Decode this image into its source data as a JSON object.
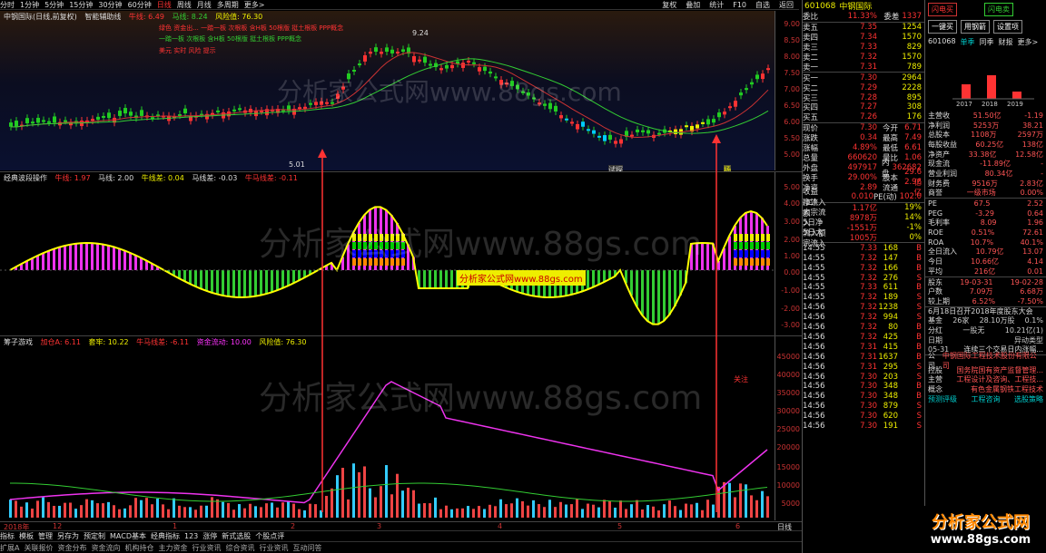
{
  "topbar": {
    "items": [
      "分时",
      "1分钟",
      "5分钟",
      "15分钟",
      "30分钟",
      "60分钟",
      "日线",
      "周线",
      "月线",
      "多周期",
      "更多>"
    ],
    "right": [
      "复权",
      "叠加",
      "统计",
      "F10",
      "自选",
      "返回"
    ]
  },
  "panel1": {
    "title": [
      "中钢国际(日线,前复权)",
      "智能辅助线",
      "牛线: 6.49",
      "马线: 8.24",
      "风险值: 76.30"
    ],
    "notes": [
      "绿色 资金出... 一踏一板 次根板 含H板 50根版 挺土根板 PPP概念",
      "一踏一板 次根板 含H板 50根版 挺土根板 PPP概念",
      "美元 实时 风险 提示"
    ],
    "price_high": "9.24",
    "price_low": "5.01",
    "axis": [
      "9.00",
      "8.50",
      "8.00",
      "7.50",
      "7.00",
      "6.50",
      "6.00",
      "5.50",
      "5.00"
    ],
    "labels": [
      "试探",
      "扬"
    ]
  },
  "panel2": {
    "title": [
      "经典波段操作",
      "牛线: 1.97",
      "马线: 2.00",
      "牛线差: 0.04",
      "马线差: -0.03",
      "牛马线差: -0.11"
    ],
    "axis": [
      "5.00",
      "4.00",
      "3.00",
      "2.00",
      "1.00",
      "0.00",
      "-1.00",
      "-2.00",
      "-3.00"
    ]
  },
  "panel3": {
    "title": [
      "筹子游戏",
      "加仓A: 6.11",
      "套牢: 10.22",
      "牛马线差: -6.11",
      "资金流动: 10.00",
      "风险值: 76.30"
    ],
    "axis": [
      "45000",
      "40000",
      "35000",
      "30000",
      "25000",
      "20000",
      "15000",
      "10000",
      "5000"
    ],
    "note": "关注"
  },
  "xaxis": [
    "2018年",
    "12",
    "1",
    "2",
    "3",
    "4",
    "5",
    "6",
    "日线"
  ],
  "tabs1": [
    "指标",
    "模板",
    "管理",
    "另存为",
    "预定制",
    "MACD基本",
    "经典指标",
    "123",
    "涨停",
    "新式选股",
    "个股点评"
  ],
  "tabs2": [
    "扩展A",
    "关联报价",
    "资金分布",
    "资金流向",
    "机构持仓",
    "主力资金",
    "行业资讯",
    "综合资讯",
    "行业资讯",
    "互动问答"
  ],
  "quote": {
    "code": "601068",
    "name": "中钢国际",
    "wb": [
      "委比",
      "11.33%",
      "委差",
      "1337"
    ],
    "asks": [
      [
        "卖五",
        "7.35",
        "1254"
      ],
      [
        "卖四",
        "7.34",
        "1570"
      ],
      [
        "卖三",
        "7.33",
        "829"
      ],
      [
        "卖二",
        "7.32",
        "1570"
      ],
      [
        "卖一",
        "7.31",
        "789"
      ]
    ],
    "bids": [
      [
        "买一",
        "7.30",
        "2964"
      ],
      [
        "买二",
        "7.29",
        "2228"
      ],
      [
        "买三",
        "7.28",
        "895"
      ],
      [
        "买四",
        "7.27",
        "308"
      ],
      [
        "买五",
        "7.26",
        "176"
      ]
    ],
    "stats": [
      [
        "现价",
        "7.30",
        "今开",
        "6.71"
      ],
      [
        "涨跌",
        "0.34",
        "最高",
        "7.49"
      ],
      [
        "涨幅",
        "4.89%",
        "最低",
        "6.61"
      ],
      [
        "总量",
        "660620",
        "量比",
        "1.06"
      ],
      [
        "外盘",
        "497917",
        "内盘",
        "362682"
      ],
      [
        "换手",
        "29.00%",
        "股本",
        "29.6亿"
      ],
      [
        "净资",
        "2.89",
        "流通",
        "2.96亿"
      ],
      [
        "收益(二)",
        "0.010",
        "PE(动)",
        "102.0"
      ]
    ],
    "flows": [
      [
        "净流入额",
        "1.17亿",
        "19%"
      ],
      [
        "大宗流入",
        "8978万",
        "14%"
      ],
      [
        "5日净流入额",
        "-1551万",
        "-1%"
      ],
      [
        "5日大宗流入",
        "1005万",
        "0%"
      ]
    ],
    "ticks": [
      [
        "14:55",
        "7.33",
        "168",
        "B"
      ],
      [
        "14:55",
        "7.32",
        "147",
        "B"
      ],
      [
        "14:55",
        "7.32",
        "166",
        "B"
      ],
      [
        "14:55",
        "7.32",
        "276",
        "S"
      ],
      [
        "14:55",
        "7.33",
        "611",
        "B"
      ],
      [
        "14:55",
        "7.32",
        "189",
        "S"
      ],
      [
        "14:56",
        "7.32",
        "1238",
        "S"
      ],
      [
        "14:56",
        "7.32",
        "994",
        "S"
      ],
      [
        "14:56",
        "7.32",
        "80",
        "B"
      ],
      [
        "14:56",
        "7.32",
        "425",
        "B"
      ],
      [
        "14:56",
        "7.31",
        "415",
        "B"
      ],
      [
        "14:56",
        "7.31",
        "1637",
        "B"
      ],
      [
        "14:56",
        "7.31",
        "295",
        "S"
      ],
      [
        "14:56",
        "7.30",
        "203",
        "S"
      ],
      [
        "14:56",
        "7.30",
        "348",
        "B"
      ],
      [
        "14:56",
        "7.30",
        "348",
        "B"
      ],
      [
        "14:56",
        "7.30",
        "879",
        "S"
      ],
      [
        "14:56",
        "7.30",
        "620",
        "S"
      ],
      [
        "14:56",
        "7.30",
        "191",
        "S"
      ]
    ]
  },
  "right": {
    "buttons": [
      "闪电买",
      "闪电卖",
      "一键买",
      "用钢箭",
      "用钢箭",
      "设置项"
    ],
    "code": "601068",
    "tabs": [
      "单季",
      "同季",
      "财报",
      "更多>"
    ],
    "bar_years": [
      "2017",
      "2018",
      "2019"
    ],
    "fin": [
      [
        "主营收",
        "51.50亿",
        "-1.19"
      ],
      [
        "净利润",
        "5253万",
        "38.21"
      ],
      [
        "总股本",
        "1108万",
        "2597万"
      ],
      [
        "每股收益",
        "60.25亿",
        "138亿"
      ],
      [
        "净资产",
        "33.38亿",
        "12.58亿"
      ],
      [
        "现金流",
        "-11.89亿",
        "-"
      ],
      [
        "营业利润",
        "80.34亿",
        "-"
      ],
      [
        "财务费",
        "9516万",
        "2.83亿"
      ],
      [
        "商誉",
        "一级市场",
        "0.00%"
      ]
    ],
    "val": [
      [
        "PE",
        "67.5",
        "2.52"
      ],
      [
        "PEG",
        "-3.29",
        "0.64"
      ],
      [
        "毛利率",
        "8.09",
        "1.96"
      ],
      [
        "ROE",
        "0.51%",
        "72.61"
      ],
      [
        "ROA",
        "10.7%",
        "40.1%"
      ],
      [
        "全日流入",
        "10.79亿",
        "13.07"
      ],
      [
        "今日",
        "10.66亿",
        "4.14"
      ],
      [
        "平均",
        "216亿",
        "0.01"
      ]
    ],
    "holders": [
      [
        "股东",
        "19-03-31",
        "19-02-28"
      ],
      [
        "户数",
        "7.09万",
        "6.68万"
      ],
      [
        "较上期",
        "6.52%",
        "-7.50%"
      ]
    ],
    "news": "6月18日召开2018年度股东大会",
    "fund": [
      "基金",
      "26家",
      "28.10万股",
      "0.1%"
    ],
    "div": [
      "分红",
      "一股无",
      "10.21亿(1)"
    ],
    "events": [
      "日期",
      "异动类型",
      "05-31",
      "连续三个交易日内涨幅..."
    ],
    "company": [
      [
        "公司",
        "中钢国际工程技术股份有限公司"
      ],
      [
        "控股",
        "国务院国有资产监督管理..."
      ],
      [
        "主营",
        "工程设计及咨询、工程技..."
      ],
      [
        "概念",
        "有色金属钢铁工程技术"
      ]
    ],
    "bottom": [
      "预测评级",
      "工程咨询",
      "选股策略"
    ],
    "logo_text": "分析家公式网",
    "logo_url": "www.88gs.com"
  },
  "watermark": [
    "分析家公式网www.88gs.com",
    "分析家公式网www.88gs.com",
    "分析家公式网www.88gs.com",
    "分析家公式网www.88gs.com"
  ]
}
